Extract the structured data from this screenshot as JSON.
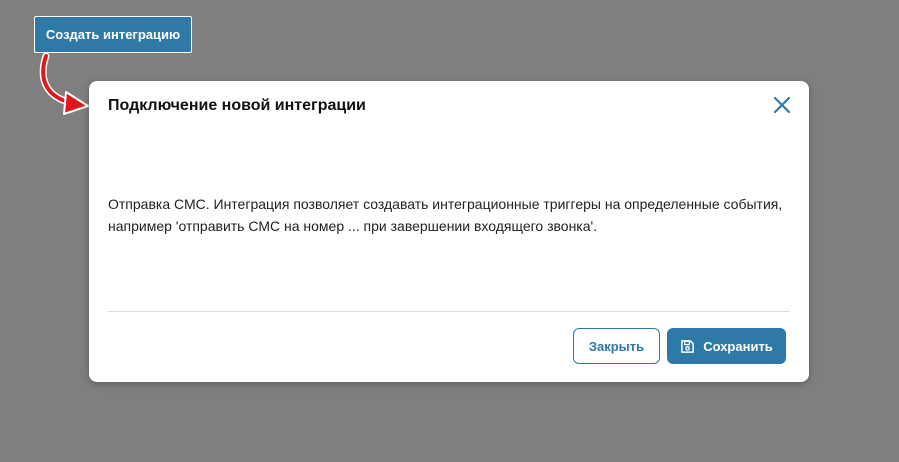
{
  "top": {
    "create_button_label": "Создать интеграцию"
  },
  "modal": {
    "title": "Подключение новой интеграции",
    "body": "Отправка СМС. Интеграция позволяет создавать интеграционные триггеры на определенные события, например 'отправить СМС на номер ... при завершении входящего звонка'.",
    "close_label": "Закрыть",
    "save_label": "Сохранить"
  },
  "colors": {
    "accent": "#2f79a6",
    "overlay": "#7f7f7f",
    "annotation_arrow": "#e0181b"
  },
  "icons": [
    "close-x-icon",
    "save-floppy-icon",
    "annotation-arrow"
  ]
}
